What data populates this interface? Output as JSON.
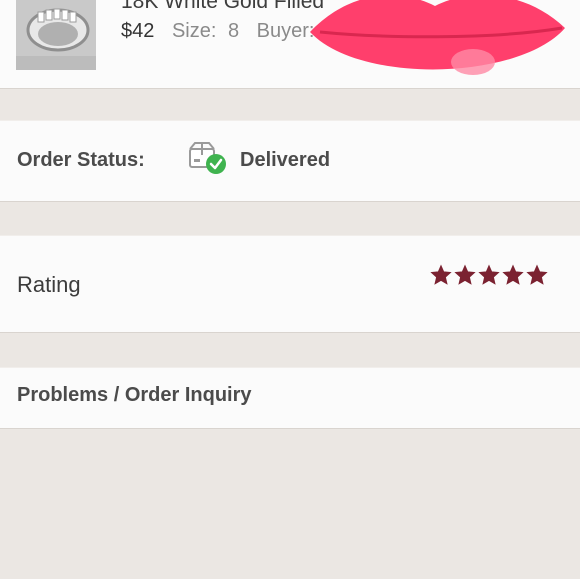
{
  "item": {
    "title": "18K White Gold Filled",
    "price": "$42",
    "size_label": "Size:",
    "size_value": "8",
    "buyer_label": "Buyer:"
  },
  "order_status": {
    "label": "Order Status:",
    "value": "Delivered",
    "icon": "package-delivered-icon"
  },
  "rating": {
    "label": "Rating",
    "stars": 5,
    "max_stars": 5,
    "star_color": "#7b2231"
  },
  "problems": {
    "label": "Problems / Order Inquiry"
  },
  "colors": {
    "background": "#ebe7e3",
    "card": "#fbfbfb",
    "delivered_check": "#3fb34f",
    "redaction": "#ff3f6c"
  }
}
